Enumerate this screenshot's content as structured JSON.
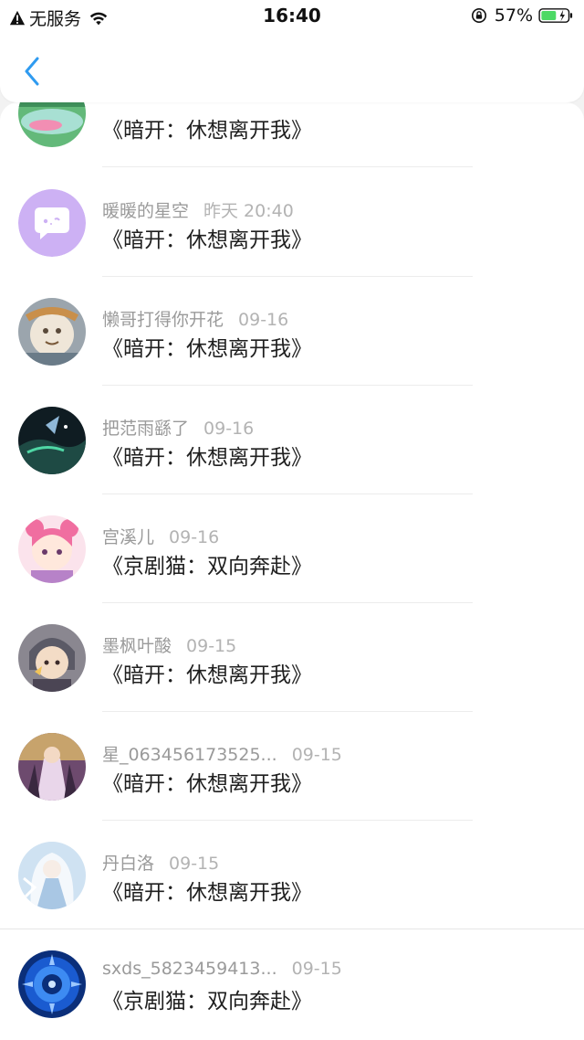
{
  "status_bar": {
    "carrier": "无服务",
    "time": "16:40",
    "battery_percent": "57%",
    "battery_level": 0.57,
    "battery_color": "#4cd964"
  },
  "header": {
    "back_icon": "chevron-left-icon",
    "accent": "#2f9bf0"
  },
  "messages": [
    {
      "user": "",
      "date": "",
      "title": "《暗开：休想离开我》"
    },
    {
      "user": "暖暖的星空",
      "date": "昨天 20:40",
      "title": "《暗开：休想离开我》"
    },
    {
      "user": "懒哥打得你开花",
      "date": "09-16",
      "title": "《暗开：休想离开我》"
    },
    {
      "user": "把范雨繇了",
      "date": "09-16",
      "title": "《暗开：休想离开我》"
    },
    {
      "user": "宫溪儿",
      "date": "09-16",
      "title": "《京剧猫：双向奔赴》"
    },
    {
      "user": "墨枫叶酸",
      "date": "09-15",
      "title": "《暗开：休想离开我》"
    },
    {
      "user": "星_063456173525...",
      "date": "09-15",
      "title": "《暗开：休想离开我》"
    },
    {
      "user": "丹白洛",
      "date": "09-15",
      "title": "《暗开：休想离开我》"
    },
    {
      "user": "sxds_5823459413...",
      "date": "09-15",
      "title": "《京剧猫：双向奔赴》"
    }
  ]
}
